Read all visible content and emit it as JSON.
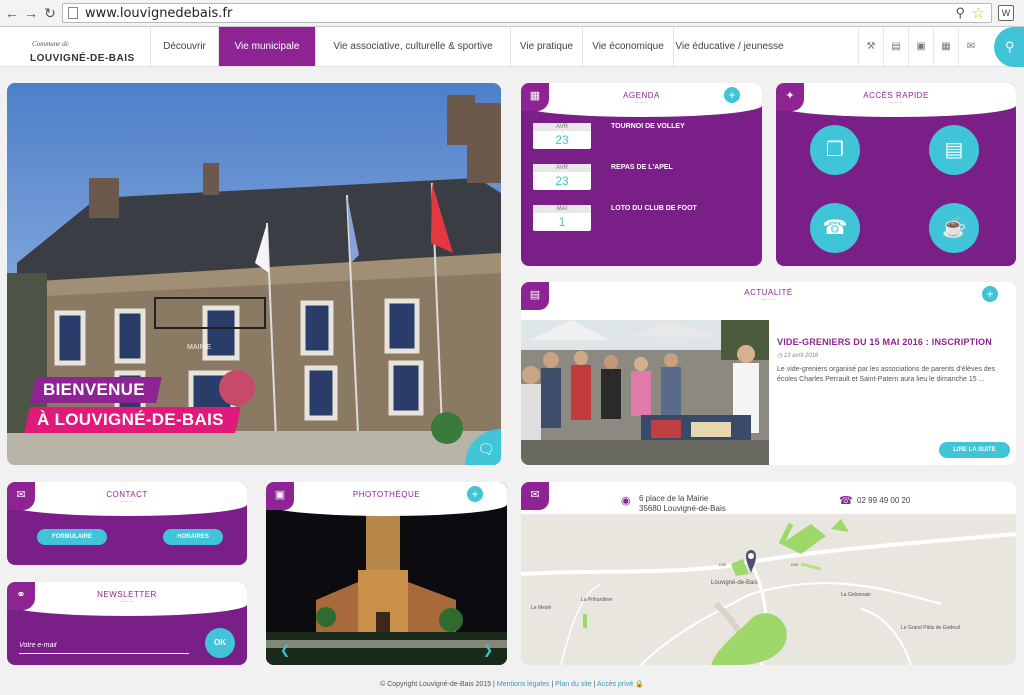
{
  "browser": {
    "url": "www.louvignedebais.fr",
    "back_icon": "arrow-left-icon",
    "forward_icon": "arrow-right-icon",
    "reload_icon": "reload-icon"
  },
  "header": {
    "logo_small": "Commune de",
    "logo_big": "LOUVIGNÉ-DE-BAIS",
    "menu": [
      {
        "label": "Découvrir",
        "width": 68
      },
      {
        "label": "Vie municipale",
        "width": 97
      },
      {
        "label": "Vie associative, culturelle & sportive",
        "width": 195
      },
      {
        "label": "Vie pratique",
        "width": 72
      },
      {
        "label": "Vie économique",
        "width": 91
      },
      {
        "label": "Vie éducative / jeunesse",
        "width": 112
      }
    ],
    "active_index": 1
  },
  "hero": {
    "line1": "BIENVENUE",
    "line2": "À LOUVIGNÉ-DE-BAIS",
    "building_sign": "MAIRIE"
  },
  "agenda": {
    "title": "AGENDA",
    "events": [
      {
        "month": "AVR",
        "day": "23",
        "title": "TOURNOI DE VOLLEY"
      },
      {
        "month": "AVR",
        "day": "23",
        "title": "REPAS DE L'APEL"
      },
      {
        "month": "MAI",
        "day": "1",
        "title": "LOTO DU CLUB DE FOOT"
      }
    ]
  },
  "quick_access": {
    "title": "ACCÈS RAPIDE"
  },
  "news": {
    "title": "ACTUALITÉ",
    "headline": "VIDE-GRENIERS DU 15 MAI 2016 : INSCRIPTION",
    "date": "13 avril 2016",
    "body": "Le vide-greniers organisé par les associations de parents d'élèves des écoles Charles Perrault et Saint-Patern aura lieu le dimanche 15 ...",
    "more": "LIRE LA SUITE"
  },
  "contact": {
    "title": "CONTACT",
    "form_label": "FORMULAIRE",
    "hours_label": "HORAIRES"
  },
  "newsletter": {
    "title": "NEWSLETTER",
    "placeholder": "Votre e-mail",
    "ok": "OK"
  },
  "gallery": {
    "title": "PHOTOTHÈQUE"
  },
  "map": {
    "address_line1": "6 place de la Mairie",
    "address_line2": "35680 Louvigné-de-Bais",
    "phone": "02 99 49 00 20",
    "labels": [
      "Louvigné-de-Bais",
      "La Gidonnais",
      "Le Grand Pâtis de Godeuil",
      "La Prihardière",
      "Le Meslé",
      "D95",
      "D95"
    ]
  },
  "footer": {
    "copyright": "© Copyright Louvigné-de-Bais 2015 |",
    "mentions": "Mentions légales",
    "sep1": "|",
    "plan": "Plan du site",
    "sep2": "|",
    "private": "Accès privé"
  },
  "colors": {
    "purple": "#8e2493",
    "cyan": "#3fc4d8",
    "pink": "#e0197a"
  }
}
